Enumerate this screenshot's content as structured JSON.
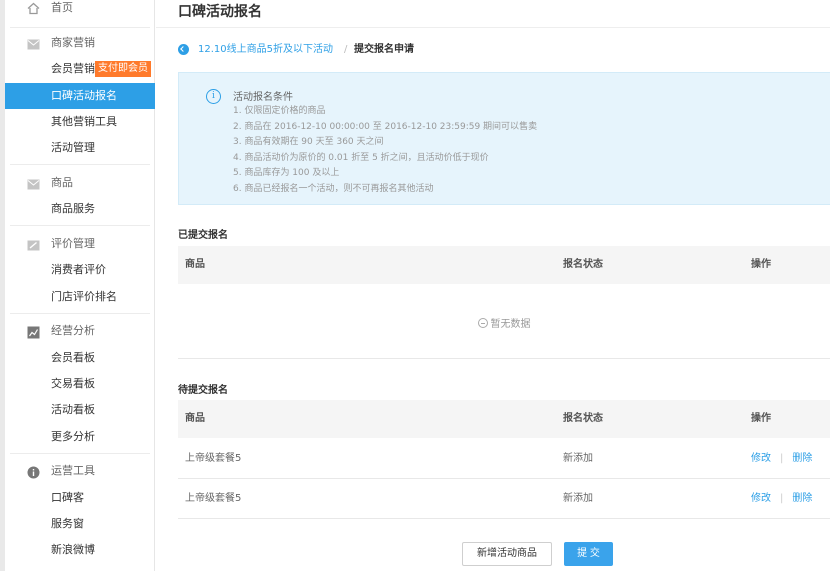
{
  "sidebar": {
    "home": {
      "label": "首页",
      "icon": "home-icon"
    },
    "sections": [
      {
        "label": "商家营销",
        "icon": "mail-icon"
      },
      {
        "label": "商品",
        "icon": "mail-icon"
      },
      {
        "label": "评价管理",
        "icon": "edit-icon"
      },
      {
        "label": "经营分析",
        "icon": "chart-icon"
      },
      {
        "label": "运营工具",
        "icon": "info-circle-icon"
      }
    ],
    "items": [
      {
        "label": "会员营销",
        "badge": "支付即会员"
      },
      {
        "label": "口碑活动报名",
        "active": true
      },
      {
        "label": "其他营销工具"
      },
      {
        "label": "活动管理"
      },
      {
        "label": "商品服务"
      },
      {
        "label": "消费者评价"
      },
      {
        "label": "门店评价排名"
      },
      {
        "label": "会员看板"
      },
      {
        "label": "交易看板"
      },
      {
        "label": "活动看板"
      },
      {
        "label": "更多分析"
      },
      {
        "label": "口碑客"
      },
      {
        "label": "服务窗"
      },
      {
        "label": "新浪微博"
      }
    ]
  },
  "page": {
    "title": "口碑活动报名",
    "breadcrumb": {
      "link": "12.10线上商品5折及以下活动",
      "separator": "/",
      "current": "提交报名申请"
    }
  },
  "notice": {
    "title": "活动报名条件",
    "icon": "info-icon",
    "lines": [
      "1. 仅限固定价格的商品",
      "2. 商品在 2016-12-10 00:00:00 至 2016-12-10 23:59:59 期间可以售卖",
      "3. 商品有效期在 90 天至 360 天之间",
      "4. 商品活动价为原价的 0.01 折至 5 折之间，且活动价低于现价",
      "5. 商品库存为 100 及以上",
      "6. 商品已经报名一个活动，则不可再报名其他活动"
    ]
  },
  "submitted": {
    "title": "已提交报名",
    "columns": [
      "商品",
      "报名状态",
      "操作"
    ],
    "empty": "暂无数据"
  },
  "pending": {
    "title": "待提交报名",
    "columns": [
      "商品",
      "报名状态",
      "操作"
    ],
    "rows": [
      {
        "product": "上帝级套餐5",
        "status": "新添加",
        "edit": "修改",
        "sep": "|",
        "delete": "删除"
      },
      {
        "product": "上帝级套餐5",
        "status": "新添加",
        "edit": "修改",
        "sep": "|",
        "delete": "删除"
      }
    ]
  },
  "actions": {
    "add": "新增活动商品",
    "submit": "提 交"
  },
  "colors": {
    "accent": "#2d9fe6",
    "badge": "#ff7a2b",
    "notice_bg": "#e6f4fc"
  }
}
